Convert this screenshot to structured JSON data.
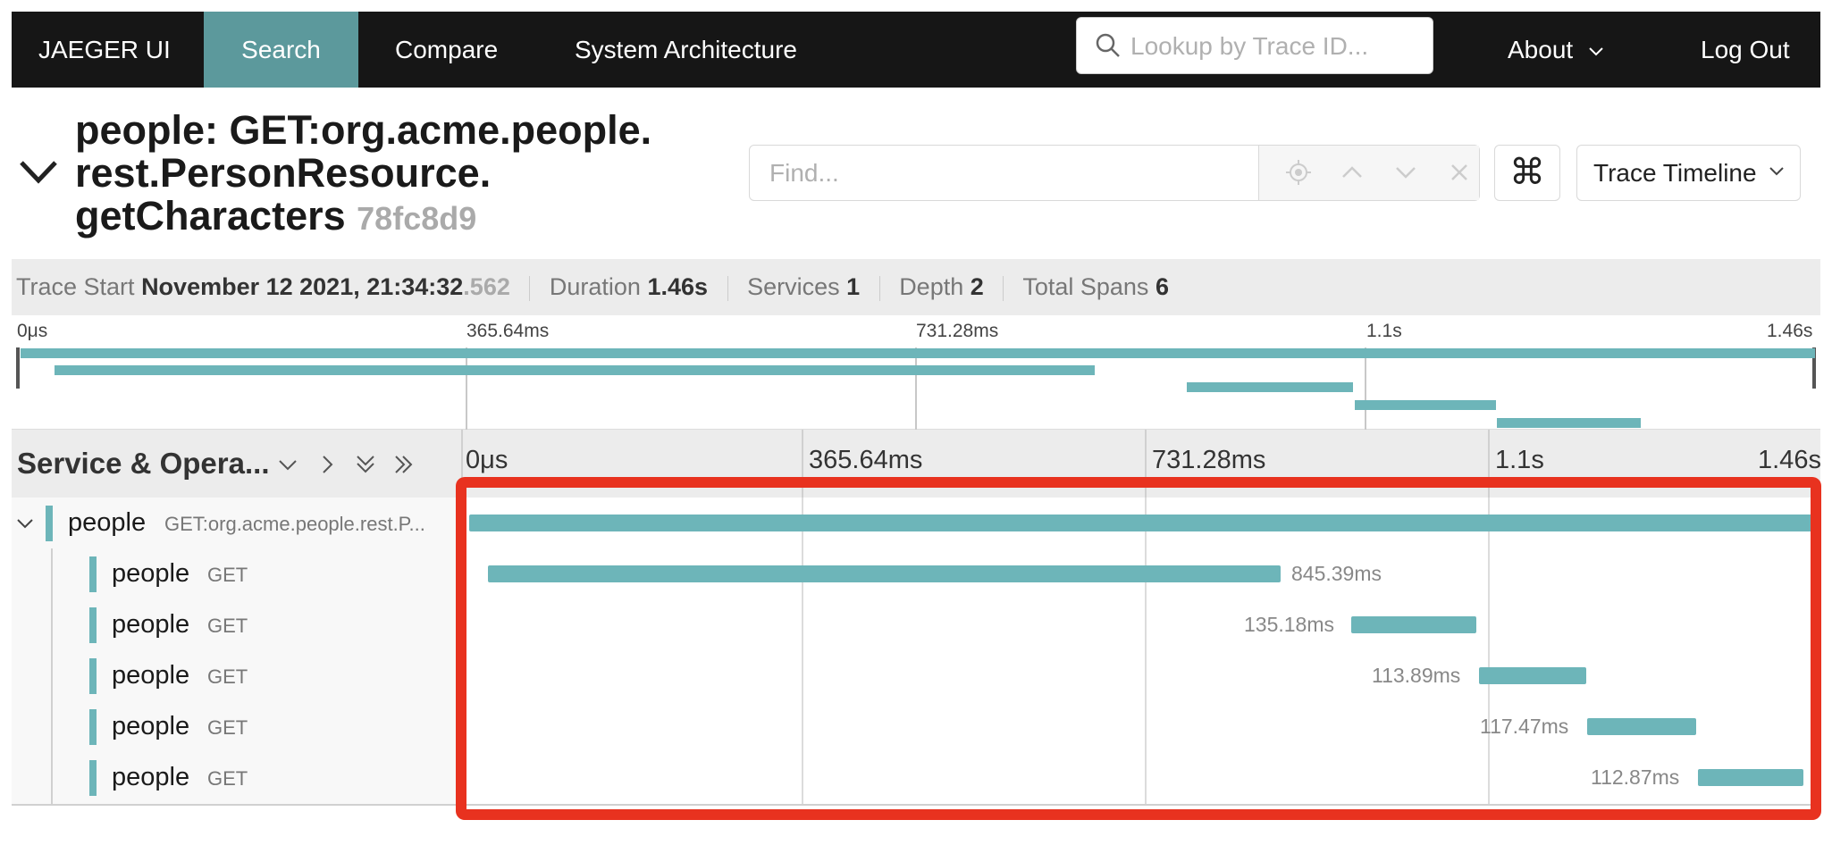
{
  "nav": {
    "brand": "JAEGER UI",
    "search": "Search",
    "compare": "Compare",
    "architecture": "System Architecture",
    "lookup_placeholder": "Lookup by Trace ID...",
    "about": "About",
    "logout": "Log Out"
  },
  "trace": {
    "title_line1": "people: GET:org.acme.people.",
    "title_line2": "rest.PersonResource.",
    "title_line3": "getCharacters",
    "trace_id": "78fc8d9"
  },
  "toolbar": {
    "find_placeholder": "Find...",
    "shortcut_glyph": "⌘",
    "view_select": "Trace Timeline"
  },
  "summary": {
    "start_label": "Trace Start",
    "start_value": "November 12 2021, 21:34:32",
    "start_ms": ".562",
    "duration_label": "Duration",
    "duration_value": "1.46s",
    "services_label": "Services",
    "services_value": "1",
    "depth_label": "Depth",
    "depth_value": "2",
    "spans_label": "Total Spans",
    "spans_value": "6"
  },
  "ticks": [
    "0μs",
    "365.64ms",
    "731.28ms",
    "1.1s",
    "1.46s"
  ],
  "span_header": {
    "title": "Service & Opera..."
  },
  "spans": [
    {
      "service": "people",
      "operation": "GET:org.acme.people.rest.P...",
      "duration": ""
    },
    {
      "service": "people",
      "operation": "GET",
      "duration": "845.39ms"
    },
    {
      "service": "people",
      "operation": "GET",
      "duration": "135.18ms"
    },
    {
      "service": "people",
      "operation": "GET",
      "duration": "113.89ms"
    },
    {
      "service": "people",
      "operation": "GET",
      "duration": "117.47ms"
    },
    {
      "service": "people",
      "operation": "GET",
      "duration": "112.87ms"
    }
  ],
  "colors": {
    "nav_bg": "#161616",
    "nav_active": "#5c999c",
    "span_bar": "#6db5b9",
    "highlight": "#e8321f"
  }
}
